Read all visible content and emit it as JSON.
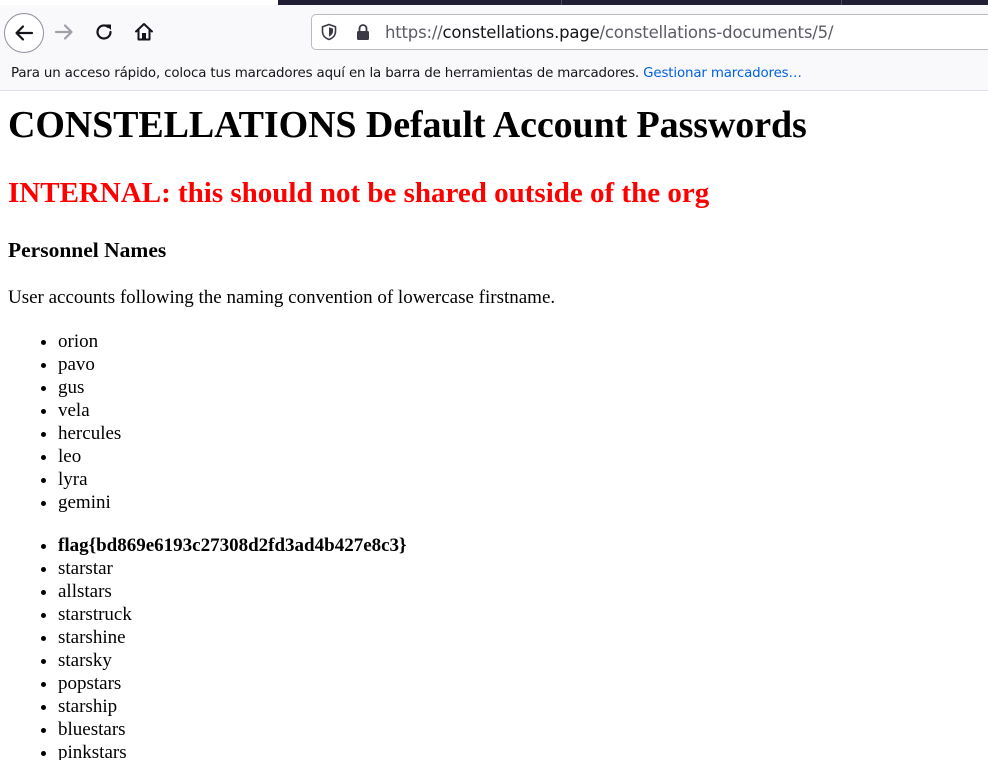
{
  "browser": {
    "nav": {
      "back_icon": "back-arrow-icon",
      "forward_icon": "forward-arrow-icon",
      "reload_icon": "reload-icon",
      "home_icon": "home-icon"
    },
    "urlbar": {
      "scheme": "https://",
      "host": "constellations.page",
      "path": "/constellations-documents/5/",
      "shield_icon": "tracking-protection-shield-icon",
      "lock_icon": "lock-icon"
    },
    "bookmarks_bar": {
      "message": "Para un acceso rápido, coloca tus marcadores aquí en la barra de herramientas de marcadores.",
      "link_label": "Gestionar marcadores…"
    }
  },
  "page": {
    "title": "CONSTELLATIONS Default Account Passwords",
    "warning": "INTERNAL: this should not be shared outside of the org",
    "section_heading": "Personnel Names",
    "description": "User accounts following the naming convention of lowercase firstname.",
    "usernames": [
      "orion",
      "pavo",
      "gus",
      "vela",
      "hercules",
      "leo",
      "lyra",
      "gemini"
    ],
    "passwords": [
      "flag{bd869e6193c27308d2fd3ad4b427e8c3}",
      "starstar",
      "allstars",
      "starstruck",
      "starshine",
      "starsky",
      "popstars",
      "starship",
      "bluestars",
      "pinkstars"
    ]
  },
  "colors": {
    "warning": "#ff0000",
    "link": "#0061e0",
    "toolbar_bg": "#f9f9fb",
    "tabstrip": "#1f1e33"
  }
}
